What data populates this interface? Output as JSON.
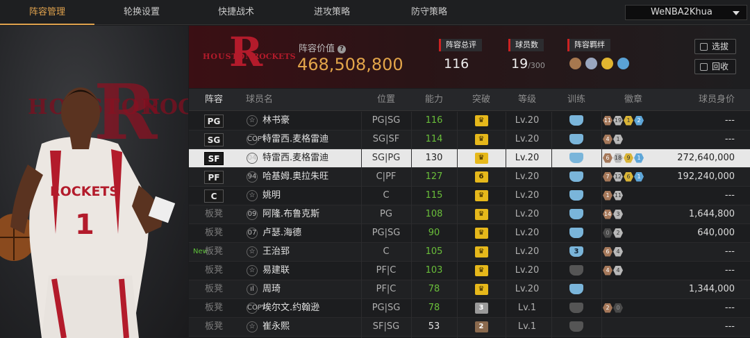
{
  "tabs": [
    "阵容管理",
    "轮换设置",
    "快捷战术",
    "进攻策略",
    "防守策略"
  ],
  "user": "WeNBA2Khua",
  "left_logo_text": "HOUSTON",
  "left_logo_text2": "ROCK",
  "team_logo": {
    "letter": "R",
    "left": "HOUSTON",
    "right": "ROCKETS"
  },
  "lineup_value_label": "阵容价值",
  "lineup_value": "468,508,800",
  "stats": {
    "overall_label": "阵容总评",
    "overall": "116",
    "count_label": "球员数",
    "count": "19",
    "count_max": "/300",
    "bond_label": "阵容羁绊"
  },
  "buttons": {
    "select": "选拔",
    "recycle": "回收"
  },
  "headers": {
    "lineup": "阵容",
    "name": "球员名",
    "position": "位置",
    "ability": "能力",
    "breakthrough": "突破",
    "level": "等级",
    "training": "训练",
    "badges": "徽章",
    "value": "球员身价"
  },
  "rows": [
    {
      "slot": "PG",
      "icon": "☆",
      "name": "林书豪",
      "position": "PG|SG",
      "ability": "116",
      "green": true,
      "brk": "gold",
      "level": "Lv.20",
      "train": "blue",
      "badges": [
        [
          "h-bronze",
          "11"
        ],
        [
          "h-silver",
          "19"
        ],
        [
          "h-gold",
          "1"
        ],
        [
          "h-blue",
          "2"
        ]
      ],
      "value": "---"
    },
    {
      "slot": "SG",
      "icon": "COPY",
      "name": "特雷西.麦格雷迪",
      "position": "SG|SF",
      "ability": "114",
      "green": true,
      "brk": "gold",
      "level": "Lv.20",
      "train": "blue",
      "badges": [
        [
          "h-bronze",
          "4"
        ],
        [
          "h-silver",
          "1"
        ]
      ],
      "value": "---"
    },
    {
      "slot": "SF",
      "icon": "04",
      "name": "特雷西.麦格雷迪",
      "position": "SG|PG",
      "ability": "130",
      "green": false,
      "brk": "gold",
      "level": "Lv.20",
      "train": "blue",
      "badges": [
        [
          "h-bronze",
          "6"
        ],
        [
          "h-silver",
          "18"
        ],
        [
          "h-gold",
          "9"
        ],
        [
          "h-blue",
          "1"
        ]
      ],
      "value": "272,640,000",
      "selected": true
    },
    {
      "slot": "PF",
      "icon": "94",
      "name": "哈基姆.奥拉朱旺",
      "position": "C|PF",
      "ability": "127",
      "green": true,
      "brk": "gold6",
      "level": "Lv.20",
      "train": "blue",
      "badges": [
        [
          "h-bronze",
          "7"
        ],
        [
          "h-silver",
          "12"
        ],
        [
          "h-gold",
          "6"
        ],
        [
          "h-blue",
          "1"
        ]
      ],
      "value": "192,240,000"
    },
    {
      "slot": "C",
      "icon": "☆",
      "name": "姚明",
      "position": "C",
      "ability": "115",
      "green": true,
      "brk": "gold",
      "level": "Lv.20",
      "train": "blue",
      "badges": [
        [
          "h-bronze",
          "1"
        ],
        [
          "h-silver",
          "11"
        ]
      ],
      "value": "---"
    },
    {
      "bench": "板凳",
      "icon": "09",
      "name": "阿隆.布鲁克斯",
      "position": "PG",
      "ability": "108",
      "green": true,
      "brk": "gold",
      "level": "Lv.20",
      "train": "blue",
      "badges": [
        [
          "h-bronze",
          "14"
        ],
        [
          "h-silver",
          "3"
        ]
      ],
      "value": "1,644,800"
    },
    {
      "bench": "板凳",
      "icon": "07",
      "name": "卢瑟.海德",
      "position": "PG|SG",
      "ability": "90",
      "green": true,
      "brk": "gold",
      "level": "Lv.20",
      "train": "blue",
      "badges": [
        [
          "h-dark",
          "0"
        ],
        [
          "h-silver",
          "2"
        ]
      ],
      "value": "640,000"
    },
    {
      "bench": "板凳",
      "new": "New",
      "icon": "☆",
      "name": "王治郅",
      "position": "C",
      "ability": "105",
      "green": true,
      "brk": "gold",
      "level": "Lv.20",
      "train": "blue3",
      "badges": [
        [
          "h-bronze",
          "6"
        ],
        [
          "h-silver",
          "4"
        ]
      ],
      "value": "---"
    },
    {
      "bench": "板凳",
      "icon": "☆",
      "name": "易建联",
      "position": "PF|C",
      "ability": "103",
      "green": true,
      "brk": "gold",
      "level": "Lv.20",
      "train": "gray",
      "badges": [
        [
          "h-bronze",
          "4"
        ],
        [
          "h-silver",
          "4"
        ]
      ],
      "value": "---"
    },
    {
      "bench": "板凳",
      "icon": "ıl",
      "name": "周琦",
      "position": "PF|C",
      "ability": "78",
      "green": true,
      "brk": "gold",
      "level": "Lv.20",
      "train": "blue",
      "badges": [],
      "value": "1,344,000"
    },
    {
      "bench": "板凳",
      "icon": "COPY",
      "name": "埃尔文.约翰逊",
      "position": "PG|SG",
      "ability": "78",
      "green": true,
      "brk": "silver3",
      "level": "Lv.1",
      "train": "gray",
      "badges": [
        [
          "h-bronze",
          "2"
        ],
        [
          "h-dark",
          "0"
        ]
      ],
      "value": "---"
    },
    {
      "bench": "板凳",
      "icon": "☆",
      "name": "崔永熙",
      "position": "SF|SG",
      "ability": "53",
      "green": false,
      "brk": "bronze2",
      "level": "Lv.1",
      "train": "gray",
      "badges": [],
      "value": "---"
    }
  ]
}
